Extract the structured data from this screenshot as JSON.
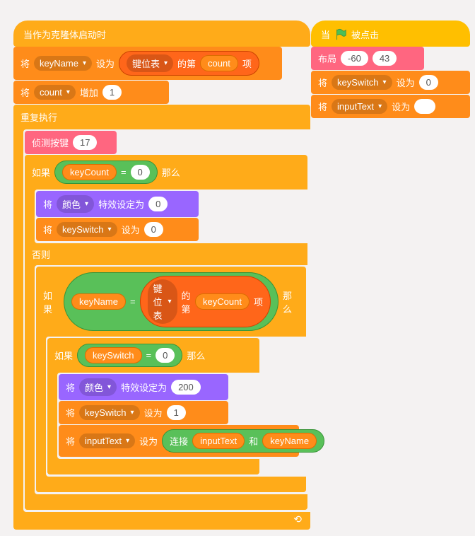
{
  "left": {
    "hat": "当作为克隆体启动时",
    "set1_prefix": "将",
    "set1_var": "keyName",
    "set1_mid": "设为",
    "set1_list_prefix": "键位表",
    "set1_list_mid": "的第",
    "set1_list_var": "count",
    "set1_list_suffix": "项",
    "set2_prefix": "将",
    "set2_var": "count",
    "set2_mid": "增加",
    "set2_val": "1",
    "forever_label": "重复执行",
    "sensing_label": "侦测按键",
    "sensing_val": "17",
    "if1_prefix": "如果",
    "if1_then": "那么",
    "cond1_var": "keyCount",
    "cond1_op": "=",
    "cond1_val": "0",
    "looks1_prefix": "将",
    "looks1_var": "颜色",
    "looks1_mid": "特效设定为",
    "looks1_val": "0",
    "set3_prefix": "将",
    "set3_var": "keySwitch",
    "set3_mid": "设为",
    "set3_val": "0",
    "else_label": "否则",
    "if2_prefix": "如果",
    "if2_then": "那么",
    "cond2_var": "keyName",
    "cond2_op": "=",
    "cond2_list_prefix": "键位表",
    "cond2_list_mid": "的第",
    "cond2_list_var": "keyCount",
    "cond2_list_suffix": "项",
    "if3_prefix": "如果",
    "if3_then": "那么",
    "cond3_var": "keySwitch",
    "cond3_op": "=",
    "cond3_val": "0",
    "looks2_prefix": "将",
    "looks2_var": "颜色",
    "looks2_mid": "特效设定为",
    "looks2_val": "200",
    "set4_prefix": "将",
    "set4_var": "keySwitch",
    "set4_mid": "设为",
    "set4_val": "1",
    "set5_prefix": "将",
    "set5_var": "inputText",
    "set5_mid": "设为",
    "join_label": "连接",
    "join_a": "inputText",
    "join_mid": "和",
    "join_b": "keyName"
  },
  "right": {
    "hat_prefix": "当",
    "hat_suffix": "被点击",
    "layout_label": "布局",
    "layout_x": "-60",
    "layout_y": "43",
    "set1_prefix": "将",
    "set1_var": "keySwitch",
    "set1_mid": "设为",
    "set1_val": "0",
    "set2_prefix": "将",
    "set2_var": "inputText",
    "set2_mid": "设为",
    "set2_val": ""
  }
}
